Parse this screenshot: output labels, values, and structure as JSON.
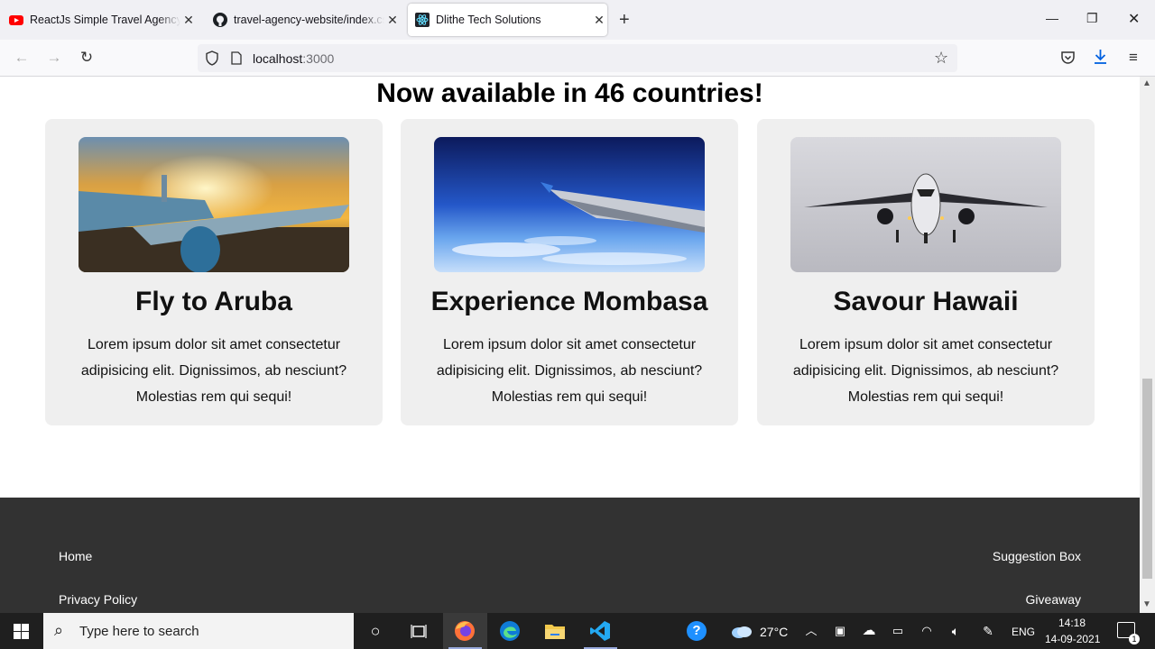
{
  "browser": {
    "tabs": [
      {
        "title": "ReactJs Simple Travel Agency La",
        "icon": "youtube-icon"
      },
      {
        "title": "travel-agency-website/index.css",
        "icon": "github-icon"
      },
      {
        "title": "Dlithe Tech Solutions",
        "icon": "react-icon"
      }
    ],
    "url": {
      "host": "localhost",
      "port": ":3000"
    }
  },
  "page": {
    "heading": "Now available in 46 countries!",
    "cards": [
      {
        "title": "Fly to Aruba",
        "text": "Lorem ipsum dolor sit amet consectetur adipisicing elit. Dignissimos, ab nesciunt? Molestias rem qui sequi!",
        "image": "plane-at-sunset"
      },
      {
        "title": "Experience Mombasa",
        "text": "Lorem ipsum dolor sit amet consectetur adipisicing elit. Dignissimos, ab nesciunt? Molestias rem qui sequi!",
        "image": "wing-above-clouds"
      },
      {
        "title": "Savour Hawaii",
        "text": "Lorem ipsum dolor sit amet consectetur adipisicing elit. Dignissimos, ab nesciunt? Molestias rem qui sequi!",
        "image": "plane-landing"
      }
    ],
    "footer": {
      "left": [
        "Home",
        "Privacy Policy"
      ],
      "right": [
        "Suggestion Box",
        "Giveaway"
      ]
    }
  },
  "taskbar": {
    "search_placeholder": "Type here to search",
    "weather": "27°C",
    "language": "ENG",
    "time": "14:18",
    "date": "14-09-2021",
    "notification_count": "1"
  },
  "colors": {
    "footer_bg": "#323232",
    "card_bg": "#efefef",
    "taskbar_bg": "#1f1f1f"
  }
}
